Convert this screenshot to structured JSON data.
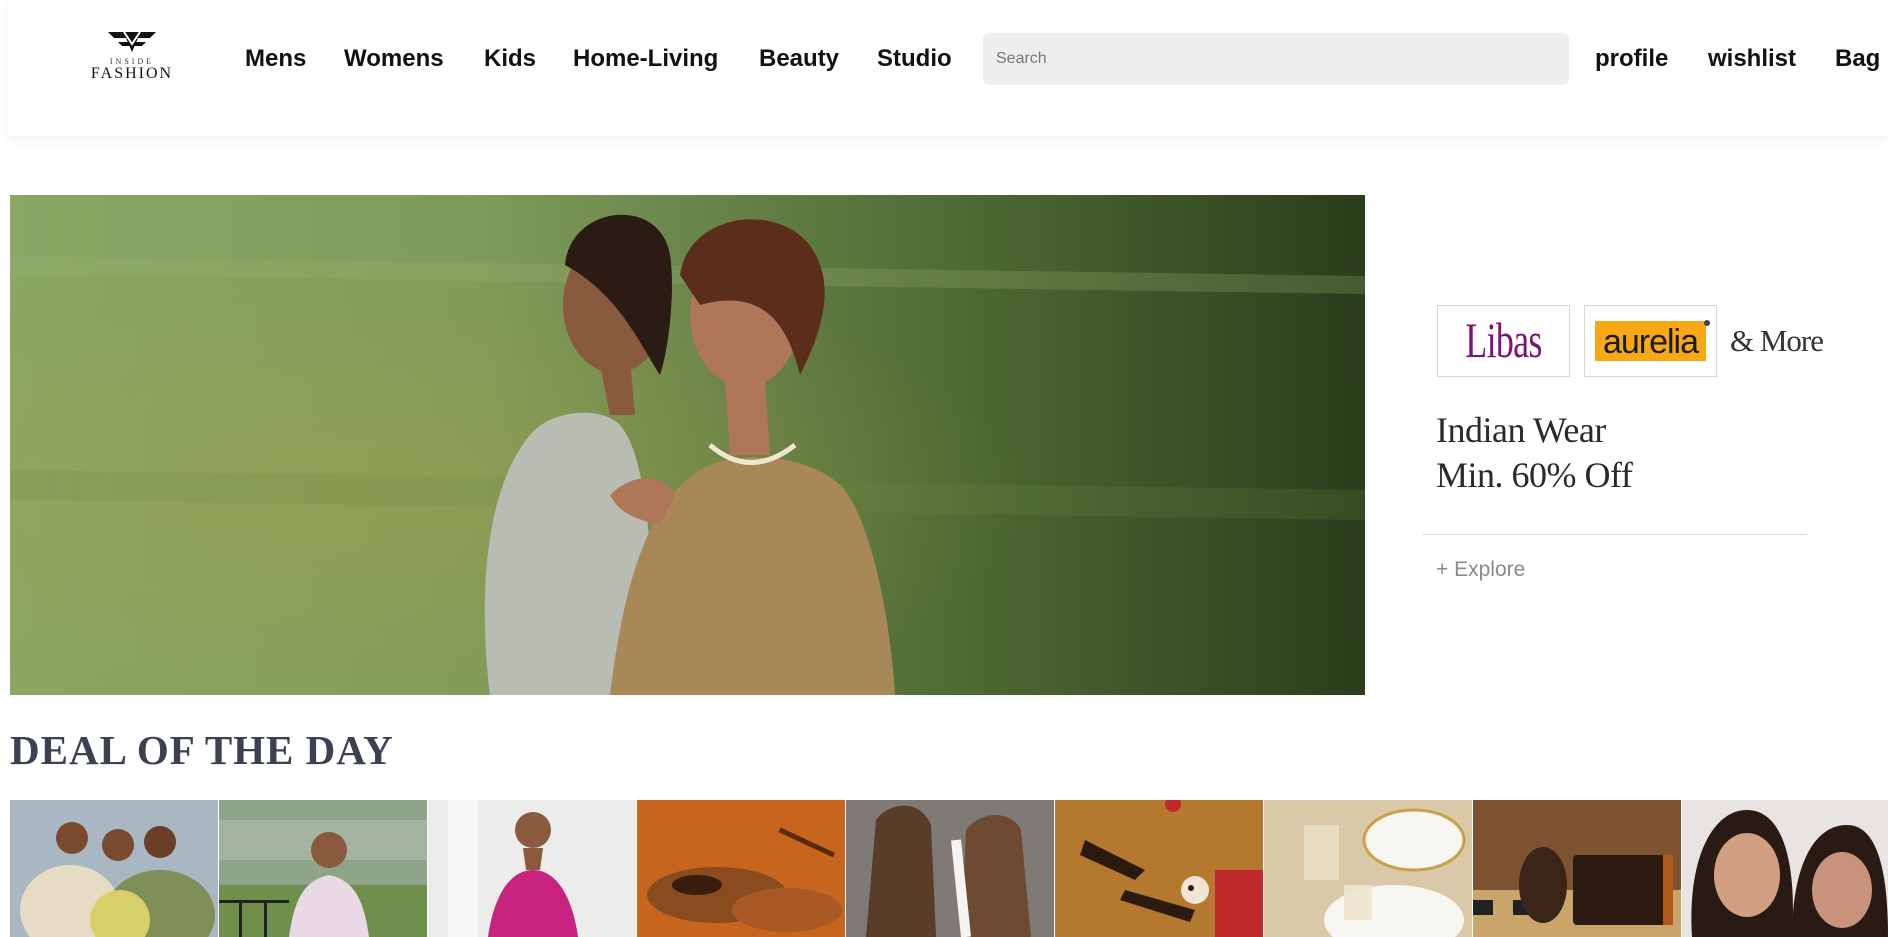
{
  "header": {
    "logo": {
      "top_text": "INSIDE",
      "bottom_text": "FASHION"
    },
    "nav": [
      "Mens",
      "Womens",
      "Kids",
      "Home-Living",
      "Beauty",
      "Studio"
    ],
    "search": {
      "placeholder": "Search",
      "value": ""
    },
    "user_links": [
      "profile",
      "wishlist",
      "Bag"
    ]
  },
  "promo": {
    "brands": [
      "Libas",
      "aurelia"
    ],
    "more_text": "& More",
    "title_lines": [
      "Indian Wear",
      "Min. 60% Off"
    ],
    "cta": "+ Explore"
  },
  "deal": {
    "title": "DEAL OF THE DAY",
    "tiles": [
      {
        "name": "casual-group"
      },
      {
        "name": "kurta"
      },
      {
        "name": "pink-dress"
      },
      {
        "name": "formal-shoes"
      },
      {
        "name": "sneakers"
      },
      {
        "name": "heels"
      },
      {
        "name": "dinnerware"
      },
      {
        "name": "belt-wallet"
      },
      {
        "name": "beauty"
      }
    ]
  },
  "colors": {
    "heading": "#3c4152",
    "libas": "#7b1474",
    "aurelia": "#f7a814",
    "search_bg": "#eeeeee"
  }
}
